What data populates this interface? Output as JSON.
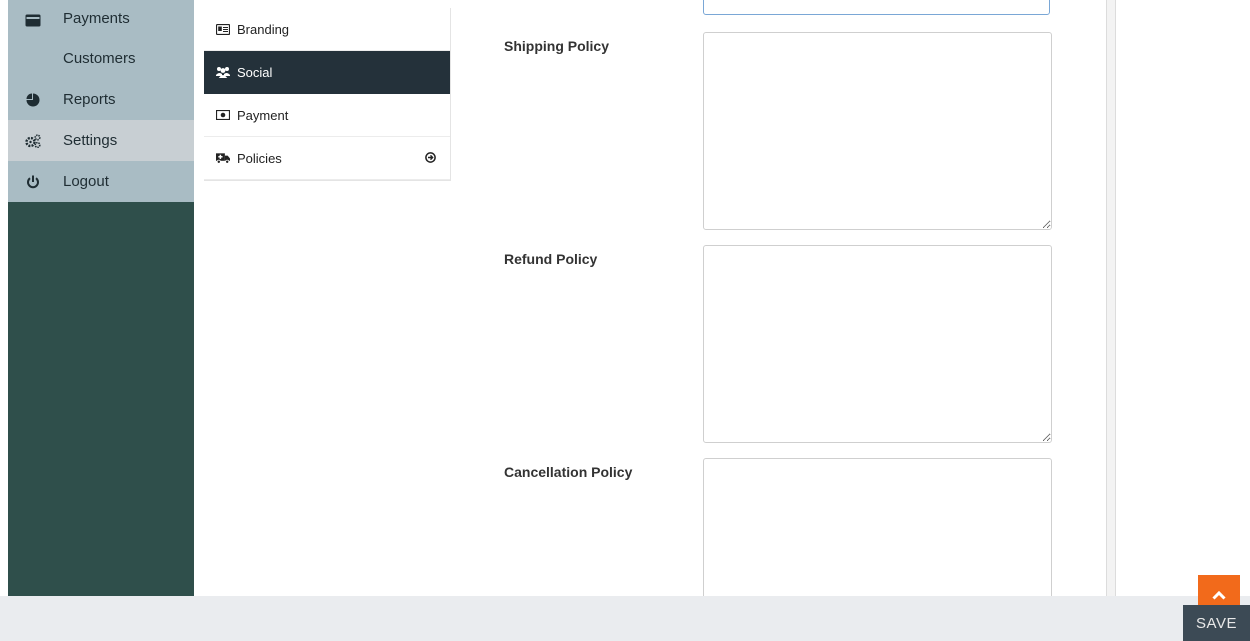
{
  "sidebar": {
    "items": [
      {
        "label": "Payments",
        "icon": "credit-card-icon",
        "active": false
      },
      {
        "label": "Customers",
        "icon": "",
        "active": false
      },
      {
        "label": "Reports",
        "icon": "pie-chart-icon",
        "active": false
      },
      {
        "label": "Settings",
        "icon": "cogs-icon",
        "active": true
      },
      {
        "label": "Logout",
        "icon": "power-icon",
        "active": false
      }
    ]
  },
  "settings_menu": {
    "tabs": [
      {
        "label": "Branding",
        "icon": "id-card-icon"
      },
      {
        "label": "Social",
        "icon": "users-icon",
        "active": true
      },
      {
        "label": "Payment",
        "icon": "money-icon"
      },
      {
        "label": "Policies",
        "icon": "ambulance-icon",
        "expand_icon": "arrow-circle-right-icon"
      }
    ]
  },
  "form": {
    "shipping_policy_label": "Shipping Policy",
    "shipping_policy_value": "",
    "refund_policy_label": "Refund Policy",
    "refund_policy_value": "",
    "cancellation_policy_label": "Cancellation Policy",
    "cancellation_policy_value": ""
  },
  "footer": {
    "save_label": "SAVE"
  },
  "colors": {
    "sidebar_bg": "#2f4f4b",
    "sidebar_menu_bg": "#a9bcc4",
    "active_tab_bg": "#24313a",
    "scroll_top_bg": "#f26a1b",
    "save_button_bg": "#3c4a55"
  }
}
